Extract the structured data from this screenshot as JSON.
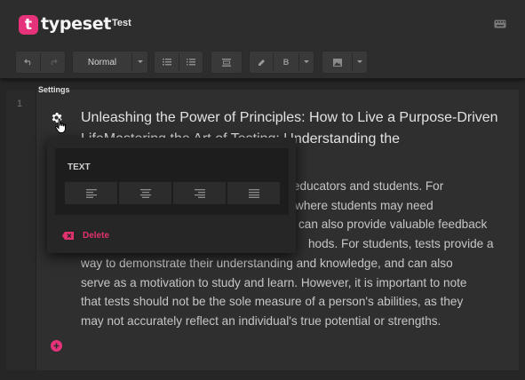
{
  "app": {
    "logo_letter": "t",
    "logo_text": "typeset",
    "doc_title": "Test"
  },
  "toolbar": {
    "undo_icon": "undo-icon",
    "redo_icon": "redo-icon",
    "paragraph_style": "Normal",
    "bullet_list_icon": "bullet-list-icon",
    "numbered_list_icon": "numbered-list-icon",
    "block_icon": "block-icon",
    "pen_icon": "pen-icon",
    "bold_label": "B",
    "image_icon": "image-icon"
  },
  "editor": {
    "settings_label": "Settings",
    "line_number": "1",
    "heading": "Unleashing the Power of Principles: How to Live a Purpose-Driven LifeMastering the Art of Testing: Understanding the",
    "paragraph_lines": [
      "educators and students. For",
      "where students may need",
      "can also provide valuable feedback",
      "hods. For students, tests provide a",
      "way to demonstrate their understanding and knowledge, and can also",
      "serve as a motivation to study and learn. However, it is important to note",
      "that tests should not be the sole measure of a person's abilities, as they",
      "may not accurately reflect an individual's true potential or strengths."
    ]
  },
  "popup": {
    "heading": "TEXT",
    "delete_label": "Delete"
  },
  "colors": {
    "accent": "#e5327a",
    "background": "#262626"
  }
}
